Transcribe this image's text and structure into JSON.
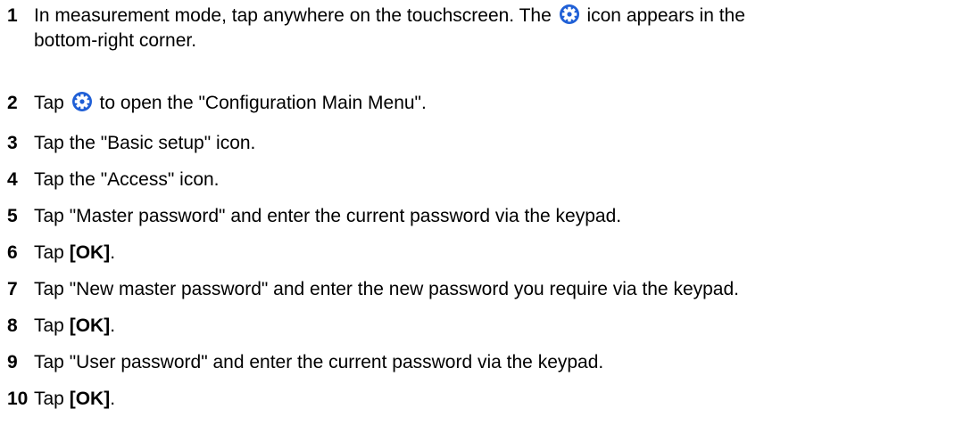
{
  "steps": [
    {
      "number": "1",
      "text_before": "In measurement mode, tap anywhere on the touchscreen. The ",
      "text_after": " icon appears in the",
      "line2": "bottom-right corner."
    },
    {
      "number": "2",
      "text_before": "Tap ",
      "text_after": " to open the \"Configuration Main Menu\"."
    },
    {
      "number": "3",
      "text": "Tap the \"Basic setup\" icon."
    },
    {
      "number": "4",
      "text": "Tap the \"Access\" icon."
    },
    {
      "number": "5",
      "text": "Tap \"Master password\" and enter the current password via the keypad."
    },
    {
      "number": "6",
      "text_before": "Tap ",
      "bold": "[OK]",
      "text_after": "."
    },
    {
      "number": "7",
      "text": "Tap \"New master password\" and enter the new password you require via the keypad."
    },
    {
      "number": "8",
      "text_before": "Tap ",
      "bold": "[OK]",
      "text_after": "."
    },
    {
      "number": "9",
      "text": "Tap \"User password\" and enter the current password via the keypad."
    },
    {
      "number": "10",
      "text_before": "Tap ",
      "bold": "[OK]",
      "text_after": "."
    }
  ],
  "icons": {
    "settings_icon": "gear-icon",
    "settings_icon_color": "#1f5fd6"
  }
}
